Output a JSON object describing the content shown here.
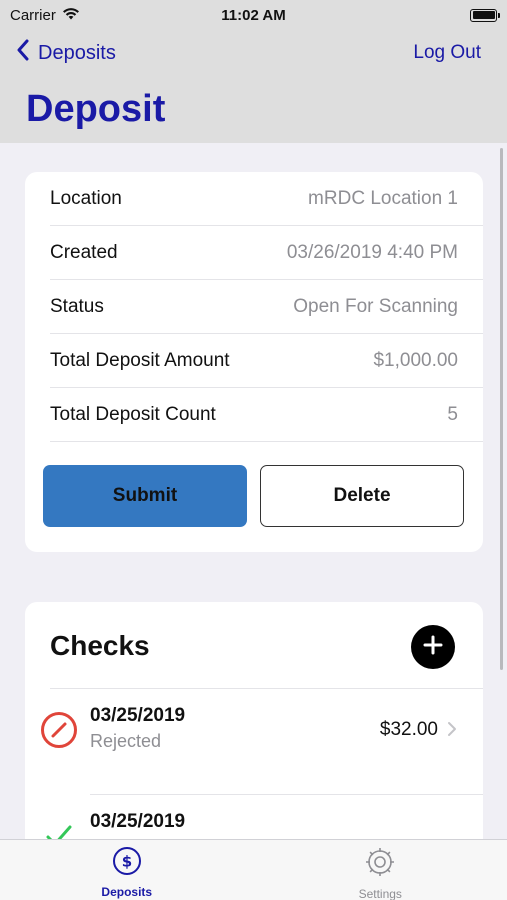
{
  "status_bar": {
    "carrier": "Carrier",
    "time": "11:02 AM"
  },
  "nav": {
    "back_label": "Deposits",
    "logout_label": "Log Out",
    "title": "Deposit"
  },
  "details": {
    "rows": [
      {
        "label": "Location",
        "value": "mRDC Location 1"
      },
      {
        "label": "Created",
        "value": "03/26/2019 4:40 PM"
      },
      {
        "label": "Status",
        "value": "Open For Scanning"
      },
      {
        "label": "Total Deposit Amount",
        "value": "$1,000.00"
      },
      {
        "label": "Total Deposit Count",
        "value": "5"
      }
    ],
    "submit_label": "Submit",
    "delete_label": "Delete"
  },
  "checks": {
    "title": "Checks",
    "items": [
      {
        "date": "03/25/2019",
        "status": "Rejected",
        "amount": "$32.00"
      },
      {
        "date": "03/25/2019",
        "status": "",
        "amount": ""
      }
    ]
  },
  "tabs": [
    {
      "label": "Deposits",
      "icon": "dollar-circle-icon",
      "active": true
    },
    {
      "label": "Settings",
      "icon": "gear-icon",
      "active": false
    }
  ],
  "colors": {
    "accent": "#1a1aa6",
    "submit": "#3478c1",
    "rejected": "#e0453a",
    "approved": "#34c759"
  }
}
